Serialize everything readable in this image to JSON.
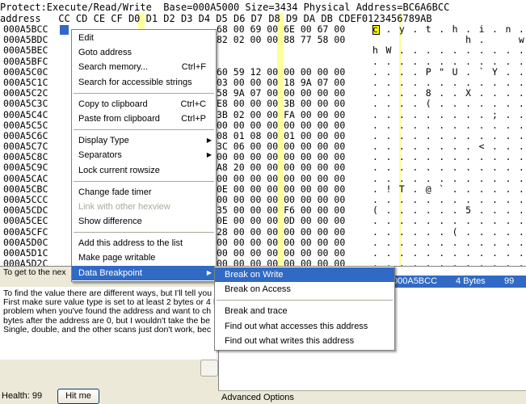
{
  "hexview": {
    "header": "Protect:Execute/Read/Write  Base=000A5000 Size=3434 Physical Address=BC6A6BCC",
    "columns": "address   CC CD CE CF D0 D1 D2 D3 D4 D5 D6 D7 D8 D9 DA DB CDEF0123456789AB",
    "rows": [
      {
        "addr": "000A5BCC",
        "bytes": "68 00 69 00 6E 00 67 00",
        "ascii": "c . y . t . h . i . n . g ."
      },
      {
        "addr": "000A5BDC",
        "bytes": "82 02 00 00 88 77 58 00",
        "ascii": "              h .     w X"
      },
      {
        "addr": "000A5BEC",
        "bytes": "",
        "ascii": "h W . . . . . . . . . . ."
      },
      {
        "addr": "000A5BFC",
        "bytes": "",
        "ascii": ". . . . . . . . . . . . ."
      },
      {
        "addr": "000A5C0C",
        "bytes": "60 59 12 00 00 00 00 00",
        "ascii": ". . . . P \" U . ` Y . . ."
      },
      {
        "addr": "000A5C1C",
        "bytes": "03 00 00 00 18 9A 07 00",
        "ascii": ". . . . . . . . . . . . ."
      },
      {
        "addr": "000A5C2C",
        "bytes": "58 9A 07 00 00 00 00 00",
        "ascii": ". . . . 8 . . X . . . . ."
      },
      {
        "addr": "000A5C3C",
        "bytes": "E8 00 00 00 3B 00 00 00",
        "ascii": ". . . . ( . . . . . . . ."
      },
      {
        "addr": "000A5C4C",
        "bytes": "3B 02 00 00 FA 00 00 00",
        "ascii": ". . . . . . . . . ; . . ."
      },
      {
        "addr": "000A5C5C",
        "bytes": "00 00 00 00 00 00 00 00",
        "ascii": ". . . . . . . . . . . . ."
      },
      {
        "addr": "000A5C6C",
        "bytes": "08 01 08 00 01 00 00 00",
        "ascii": ". . . . . . . . . . . . ."
      },
      {
        "addr": "000A5C7C",
        "bytes": "3C 06 00 00 00 00 00 00",
        "ascii": ". . . . . . . . < . . . ."
      },
      {
        "addr": "000A5C8C",
        "bytes": "00 00 00 00 00 00 00 00",
        "ascii": ". . . . . . . . . . . . ."
      },
      {
        "addr": "000A5C9C",
        "bytes": "A8 20 00 00 00 00 00 00",
        "ascii": ". . . . . . . . . . . . ."
      },
      {
        "addr": "000A5CAC",
        "bytes": "00 00 00 00 00 00 00 00",
        "ascii": ". . . . . . . . . . . . ."
      },
      {
        "addr": "000A5CBC",
        "bytes": "0E 00 00 00 00 00 00 00",
        "ascii": ". ! T . @ ` . . . . . . ."
      },
      {
        "addr": "000A5CCC",
        "bytes": "00 00 00 00 00 00 00 00",
        "ascii": ". . . . . . . . . . . . ."
      },
      {
        "addr": "000A5CDC",
        "bytes": "35 00 00 00 F6 00 00 00",
        "ascii": "( . . . . . . 5 . . . . ."
      },
      {
        "addr": "000A5CEC",
        "bytes": "0E 00 00 00 0D 00 00 00",
        "ascii": ". . . . . . . . . . . . ."
      },
      {
        "addr": "000A5CFC",
        "bytes": "28 00 00 00 00 00 00 00",
        "ascii": ". . . . . . ( . . . . . ."
      },
      {
        "addr": "000A5D0C",
        "bytes": "00 00 00 00 00 00 00 00",
        "ascii": ". . . . . . . . . . . . ."
      },
      {
        "addr": "000A5D1C",
        "bytes": "00 00 00 00 00 00 00 00",
        "ascii": ". . . . . . . . . . . . ."
      },
      {
        "addr": "000A5D2C",
        "bytes": "00 00 00 00 00 00 00 00",
        "ascii": ". . . . . . . . . . . . ."
      }
    ]
  },
  "tutorial": {
    "title": "To get to the nex",
    "lines": [
      "To find the value there are different ways, but I'll tell you",
      "First make sure value type is set to at least 2 bytes or 4 I",
      "problem when you've found the address and want to ch",
      "bytes after the address are 0, but I wouldn't take the be",
      "Single, double, and the other scans just don't work, bec"
    ]
  },
  "footer": {
    "health_label": "Health:  99",
    "hit_button": "Hit me",
    "advanced_options": "Advanced Options"
  },
  "address_list": {
    "address": "000A5BCC",
    "type": "4 Bytes",
    "value": "99"
  },
  "context_menu": {
    "edit": "Edit",
    "goto": "Goto address",
    "search_memory": "Search memory...",
    "search_memory_sc": "Ctrl+F",
    "search_strings": "Search for accessible strings",
    "copy": "Copy to clipboard",
    "copy_sc": "Ctrl+C",
    "paste": "Paste from clipboard",
    "paste_sc": "Ctrl+P",
    "display_type": "Display Type",
    "separators": "Separators",
    "lock_rowsize": "Lock current rowsize",
    "fade_timer": "Change fade timer",
    "link_hexview": "Link with other hexview",
    "show_difference": "Show difference",
    "add_address": "Add this address to the list",
    "make_writable": "Make page writable",
    "data_breakpoint": "Data Breakpoint"
  },
  "sub_menu": {
    "break_write": "Break on Write",
    "break_access": "Break on Access",
    "break_trace": "Break and trace",
    "find_accesses": "Find out what accesses this address",
    "find_writes": "Find out what writes this address"
  },
  "colors": {
    "highlight": "#316ac5",
    "column_highlight": "#ffff9c",
    "window_bg": "#ece9d8"
  }
}
